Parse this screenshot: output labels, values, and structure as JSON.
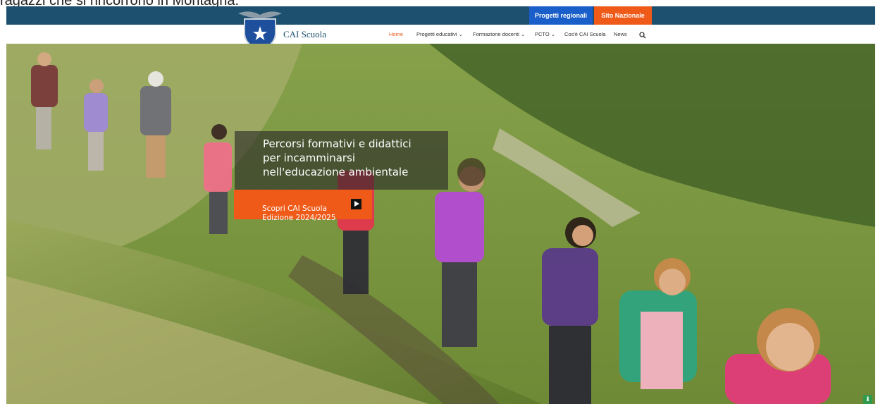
{
  "caption": "ragazzi che si rincorrono in Montagna.",
  "topbar": {
    "regional_label": "Progetti regionali",
    "national_label": "Sito Nazionale"
  },
  "navbar": {
    "brand": "CAI Scuola",
    "items": [
      {
        "label": "Home"
      },
      {
        "label": "Progetti educativi ⌄"
      },
      {
        "label": "Formazione docenti ⌄"
      },
      {
        "label": "PCTO ⌄"
      },
      {
        "label": "Cos'è CAI Scuola"
      },
      {
        "label": "News"
      }
    ],
    "search_icon": "search-icon"
  },
  "hero": {
    "headline": "Percorsi formativi e didattici\nper incamminarsi\nnell'educazione ambientale",
    "cta_label": "Scopri CAI Scuola\nEdizione 2024/2025",
    "cta_icon": "play-icon",
    "scroll_icon": "arrow-down-icon"
  },
  "colors": {
    "topbar": "#1d4f6e",
    "regional": "#1a5fc9",
    "national": "#f05a19",
    "accent": "#ef5a18"
  }
}
